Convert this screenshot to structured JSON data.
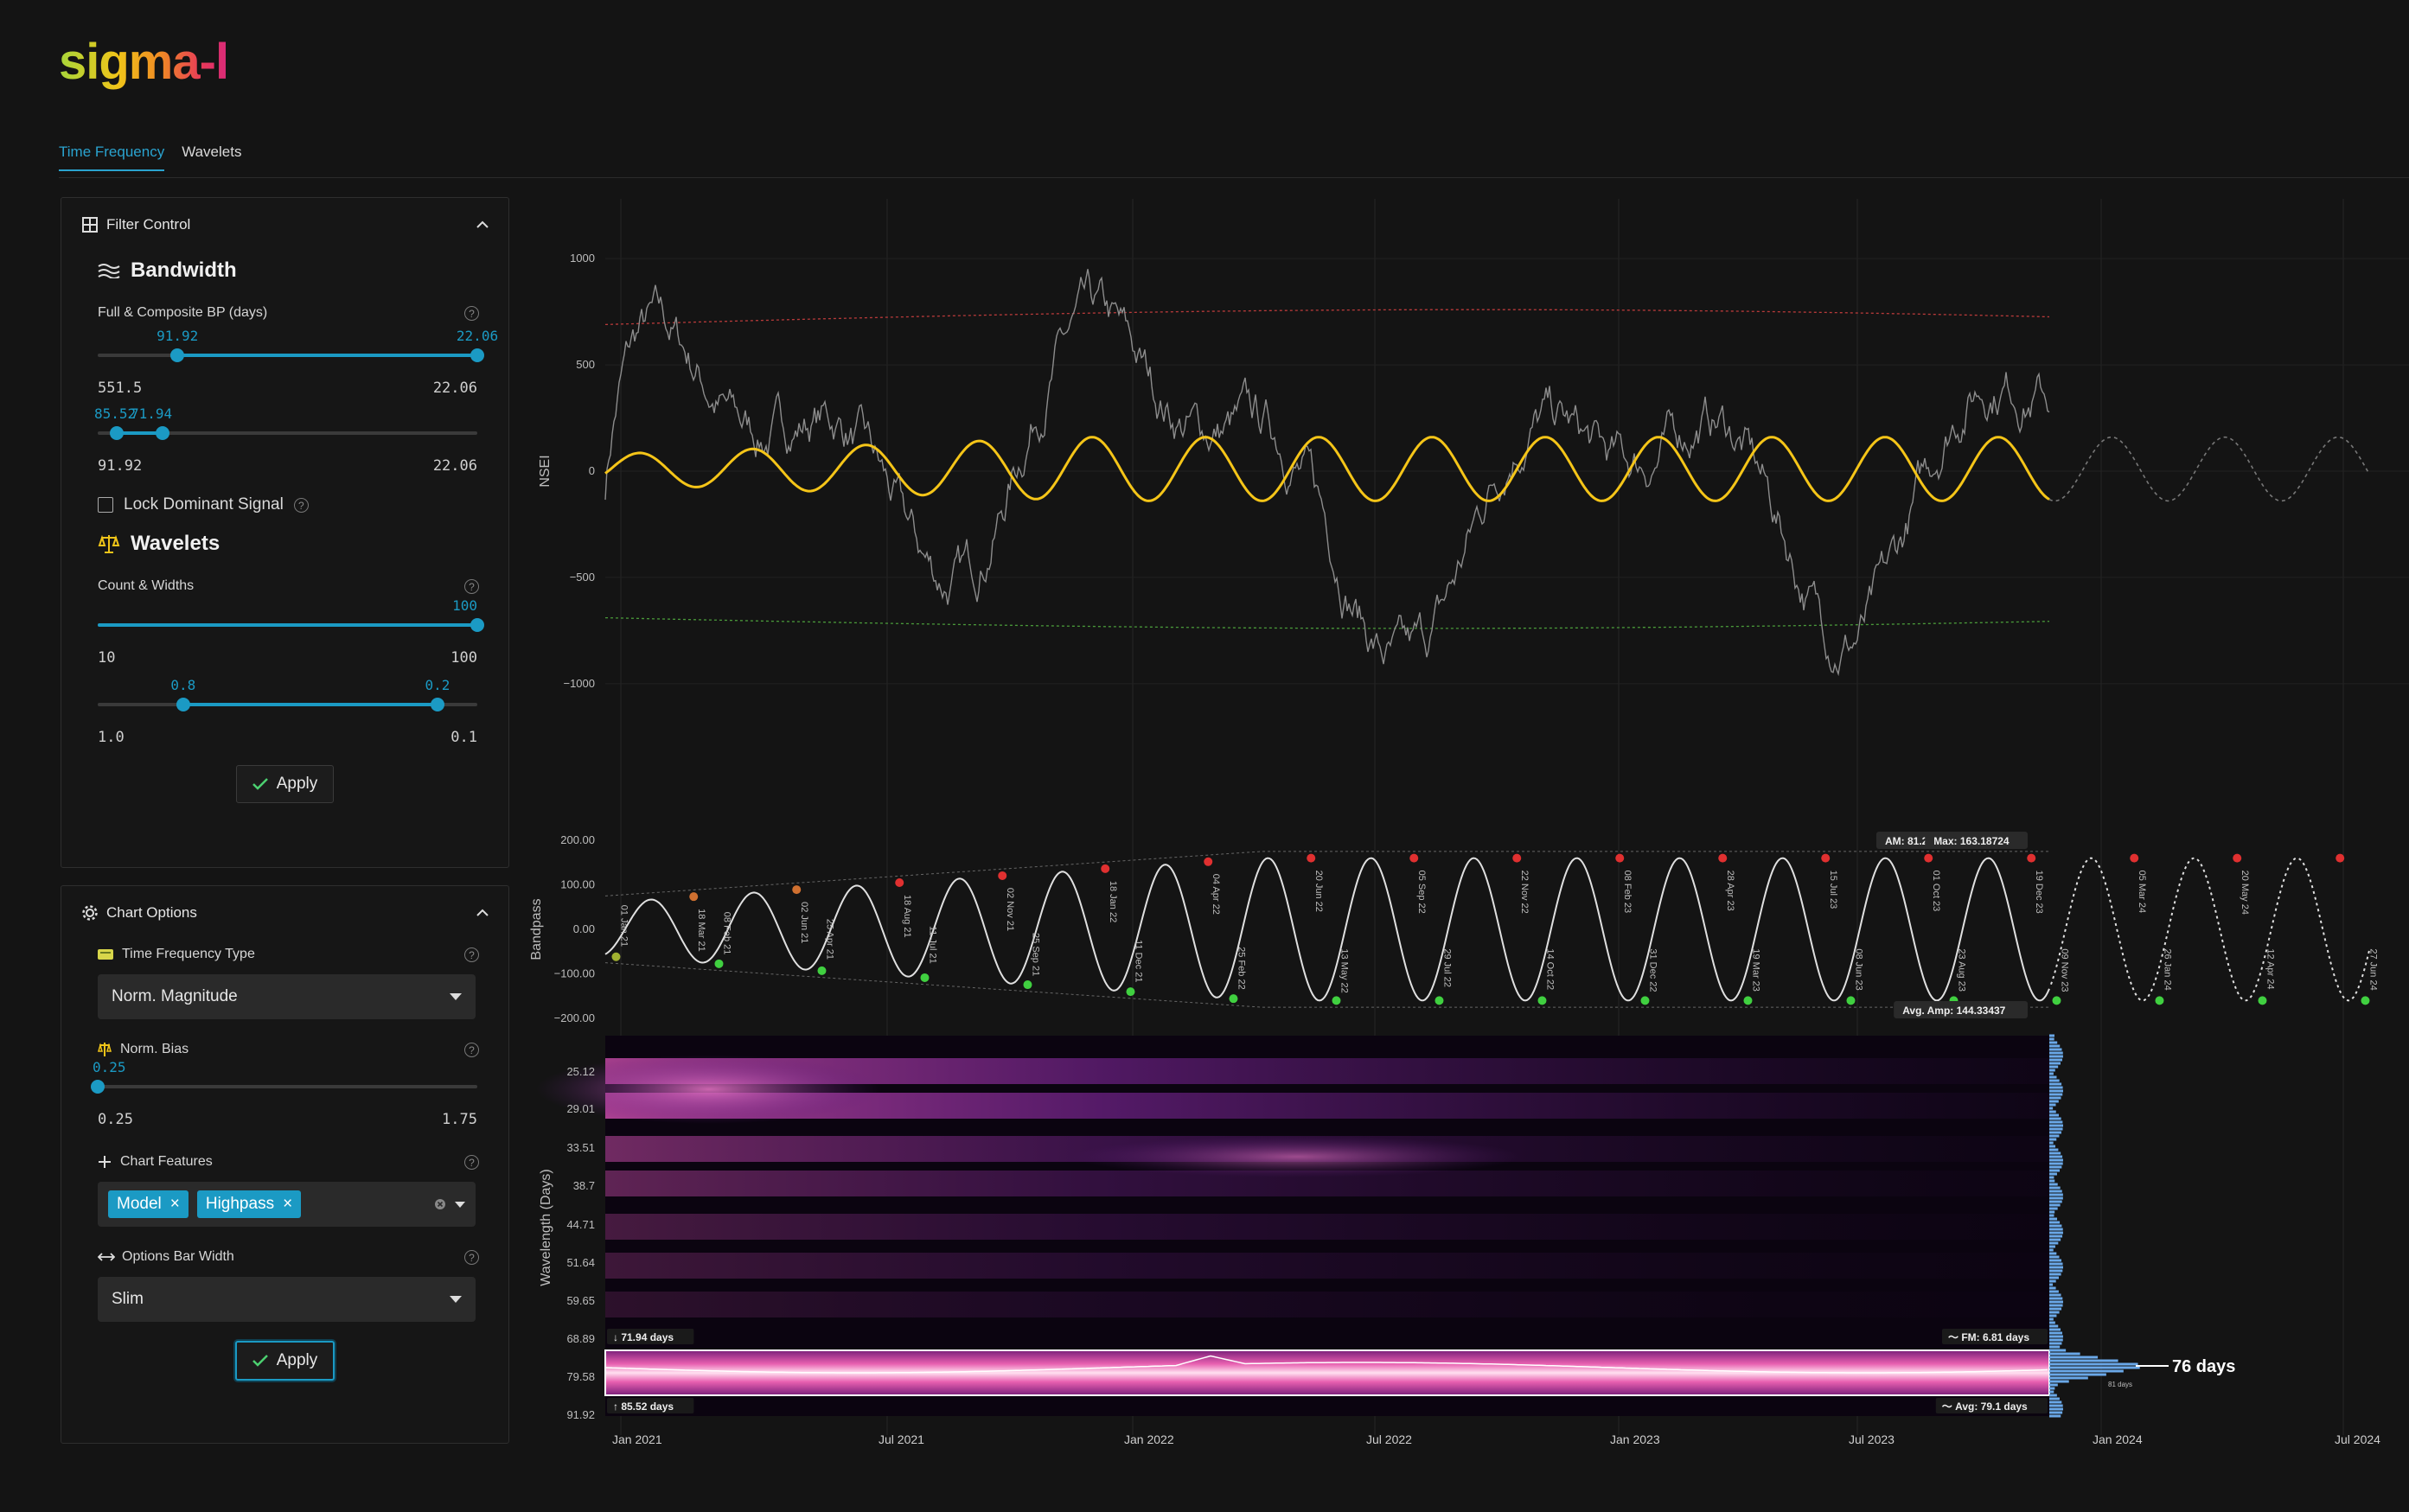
{
  "app": {
    "logo": "sigma-l"
  },
  "tabs": [
    {
      "label": "Time Frequency",
      "active": true
    },
    {
      "label": "Wavelets",
      "active": false
    }
  ],
  "filter_control": {
    "title": "Filter Control",
    "bandwidth": {
      "title": "Bandwidth",
      "label": "Full & Composite BP (days)",
      "slider1": {
        "low_label": "91.92",
        "high_label": "22.06",
        "min": "551.5",
        "max": "22.06",
        "low_fraction": 0.21,
        "high_fraction": 1.0
      },
      "slider2": {
        "low_label": "85.52",
        "high_label": "71.94",
        "min": "91.92",
        "max": "22.06",
        "low_fraction": 0.05,
        "high_fraction": 0.17
      }
    },
    "lock_dominant_label": "Lock Dominant Signal",
    "wavelets": {
      "title": "Wavelets",
      "label": "Count & Widths",
      "count_slider": {
        "value_label": "100",
        "min": "10",
        "max": "100",
        "fraction": 1.0
      },
      "width_slider": {
        "low_label": "0.8",
        "high_label": "0.2",
        "min": "1.0",
        "max": "0.1",
        "low_fraction": 0.225,
        "high_fraction": 0.895
      }
    },
    "apply_label": "Apply"
  },
  "chart_options": {
    "title": "Chart Options",
    "tf_type_label": "Time Frequency Type",
    "tf_type_value": "Norm. Magnitude",
    "norm_bias_label": "Norm. Bias",
    "norm_bias_slider": {
      "value_label": "0.25",
      "min": "0.25",
      "max": "1.75",
      "fraction": 0.0
    },
    "features_label": "Chart Features",
    "features": [
      "Model",
      "Highpass"
    ],
    "bar_width_label": "Options Bar Width",
    "bar_width_value": "Slim",
    "apply_label": "Apply"
  },
  "chart_data": [
    {
      "type": "line",
      "ylabel": "NSEI",
      "yticks": [
        "1000",
        "500",
        "0",
        "−500",
        "−1000"
      ],
      "ylim": [
        -1200,
        1200
      ],
      "series": [
        {
          "values_note_free": true,
          "color": "#8a8a8a"
        },
        {
          "color": "#f5c518"
        }
      ],
      "upper_band": 720,
      "lower_band": -720
    },
    {
      "type": "line",
      "ylabel": "Bandpass",
      "yticks": [
        "200.00",
        "100.00",
        "0.00",
        "−100.00",
        "−200.00"
      ],
      "ylim": [
        -200,
        200
      ],
      "peak_dates": [
        "18 Mar 21",
        "02 Jun 21",
        "18 Aug 21",
        "02 Nov 21",
        "18 Jan 22",
        "04 Apr 22",
        "20 Jun 22",
        "05 Sep 22",
        "22 Nov 22",
        "08 Feb 23",
        "28 Apr 23",
        "15 Jul 23",
        "01 Oct 23",
        "19 Dec 23",
        "05 Mar 24",
        "20 May 24"
      ],
      "trough_dates": [
        "01 Jan 21",
        "08 Feb 21",
        "25 Apr 21",
        "11 Jul 21",
        "25 Sep 21",
        "11 Dec 21",
        "25 Feb 22",
        "13 May 22",
        "29 Jul 22",
        "14 Oct 22",
        "31 Dec 22",
        "19 Mar 23",
        "08 Jun 23",
        "23 Aug 23",
        "09 Nov 23",
        "26 Jan 24",
        "12 Apr 24",
        "27 Jun 24"
      ],
      "am_label": "AM: 81.22560",
      "max_label": "Max: 163.18724",
      "avg_amp_label": "Avg. Amp: 144.33437"
    },
    {
      "type": "heatmap",
      "ylabel": "Wavelength (Days)",
      "yticks": [
        "25.12",
        "29.01",
        "33.51",
        "38.7",
        "44.71",
        "51.64",
        "59.65",
        "68.89",
        "79.58",
        "91.92"
      ],
      "xticks": [
        "Jan 2021",
        "Jul 2021",
        "Jan 2022",
        "Jul 2022",
        "Jan 2023",
        "Jul 2023",
        "Jan 2024",
        "Jul 2024"
      ],
      "band_top_label": "71.94 days",
      "band_bottom_label": "85.52 days",
      "fm_label": "FM: 6.81 days",
      "avg_label": "Avg: 79.1 days",
      "dominant_label": "76 days",
      "small_label": "81 days"
    }
  ]
}
